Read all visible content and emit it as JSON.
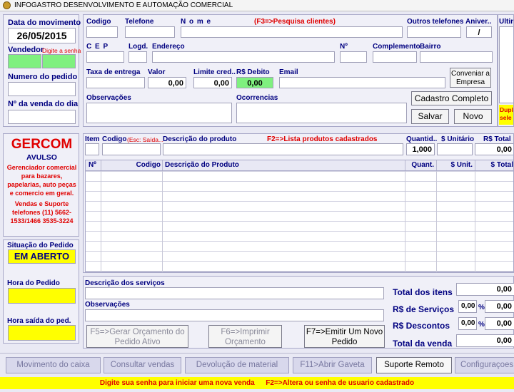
{
  "window": {
    "title": "INFOGASTRO DESENVOLVIMENTO E AUTOMAÇÃO COMERCIAL"
  },
  "left": {
    "date_label": "Data do movimento",
    "date_value": "26/05/2015",
    "seller_label": "Vendedor",
    "seller_hint": "Digite a senha",
    "order_number_label": "Numero do pedido",
    "day_sale_label": "Nº da venda do dia",
    "logo": {
      "title": "GERCOM",
      "subtitle": "AVULSO",
      "desc": "Gerenciador comercial para bazares, papelarias, auto peças e comercio em geral.",
      "support": "Vendas e Suporte telefones (11) 5662-1533/1466 3535-3224"
    },
    "status_label": "Situação do Pedido",
    "status_value": "EM ABERTO",
    "order_time_label": "Hora do Pedido",
    "exit_time_label": "Hora saída do ped."
  },
  "customer": {
    "code_label": "Codigo",
    "phone_label": "Telefone",
    "name_label": "N o m e",
    "name_hint": "(F3=>Pesquisa clientes)",
    "other_phones_label": "Outros telefones",
    "birthday_label": "Aniver..",
    "birthday_value": "/",
    "last_label": "Ultim",
    "cep_label": "C E P",
    "logd_label": "Logd.",
    "address_label": "Endereço",
    "number_label": "Nº",
    "complement_label": "Complemento",
    "district_label": "Bairro",
    "delivery_fee_label": "Taxa de entrega",
    "value_label": "Valor",
    "value_value": "0,00",
    "credit_limit_label": "Limite cred..",
    "credit_limit_value": "0,00",
    "debit_label": "R$  Debito",
    "debit_value": "0,00",
    "email_label": "Email",
    "notes_label": "Observações",
    "occurrences_label": "Ocorrencias",
    "agreement_button": "Conveniar a Empresa",
    "full_register_button": "Cadastro Completo",
    "save_button": "Salvar",
    "new_button": "Novo",
    "hint_yellow": "Duplo sele"
  },
  "item_entry": {
    "item_label": "Item",
    "code_label": "Codigo",
    "code_hint": "(Esc: Saída...",
    "desc_label": "Descrição do produto",
    "desc_hint": "F2=>Lista produtos cadastrados",
    "qty_label": "Quantid..",
    "qty_value": "1,000",
    "unit_label": "$ Unitário",
    "total_label": "R$ Total",
    "total_value": "0,00"
  },
  "grid": {
    "columns": [
      "Nº",
      "Codigo",
      "Descrição do Produto",
      "Quant.",
      "$ Unit.",
      "$ Total"
    ]
  },
  "services": {
    "desc_label": "Descrição dos serviços",
    "notes_label": "Observações"
  },
  "totals": {
    "items_label": "Total  dos itens",
    "items_value": "0,00",
    "services_label": "R$ de Serviços",
    "services_pct": "0,00",
    "services_value": "0,00",
    "discounts_label": "R$  Descontos",
    "discounts_pct": "0,00",
    "discounts_value": "0,00",
    "sale_label": "Total da venda",
    "sale_value": "0,00",
    "pct_symbol": "%"
  },
  "actions": {
    "f5": "F5=>Gerar Orçamento do Pedido Ativo",
    "f6": "F6=>Imprimir Orçamento",
    "f7": "F7=>Emitir Um Novo Pedido"
  },
  "toolbar": {
    "items": [
      "Movimento do caixa",
      "Consultar vendas",
      "Devolução de material",
      "F11>Abrir Gaveta",
      "Suporte Remoto",
      "Configuraçoes"
    ]
  },
  "status_bar": {
    "left": "Digite sua senha para iniciar uma nova venda",
    "right": "F2=>Altera ou senha de usuario cadastrado"
  }
}
